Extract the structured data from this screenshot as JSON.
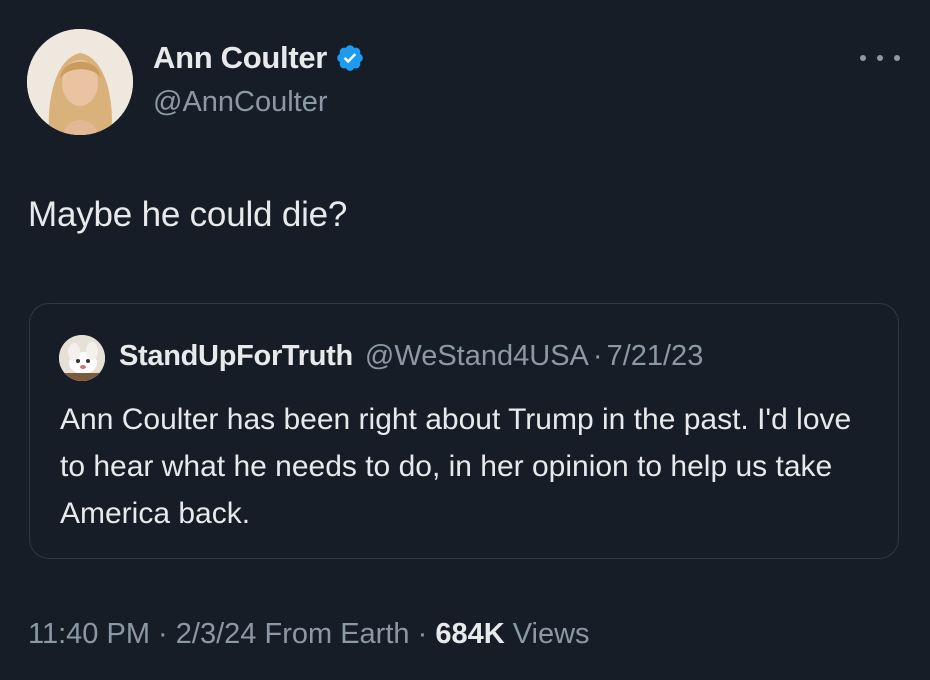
{
  "author": {
    "display_name": "Ann Coulter",
    "handle": "@AnnCoulter",
    "verified": true,
    "verified_color": "#1d9bf0"
  },
  "tweet": {
    "text": "Maybe he could die?"
  },
  "quoted_tweet": {
    "display_name": "StandUpForTruth",
    "handle": "@WeStand4USA",
    "separator": "·",
    "date": "7/21/23",
    "text": "Ann Coulter has been right about Trump in the past. I'd love to hear what he needs to do, in her opinion to help us take America back."
  },
  "meta": {
    "time": "11:40 PM",
    "sep1": "·",
    "date": "2/3/24",
    "source": "From Earth",
    "sep2": "·",
    "views_count": "684K",
    "views_label": "Views"
  },
  "icons": {
    "more": "more-options-icon",
    "verified": "verified-badge-icon"
  },
  "colors": {
    "background": "#161d27",
    "primary_text": "#e7e9ea",
    "secondary_text": "#8b98a5",
    "border": "#2f3942"
  }
}
